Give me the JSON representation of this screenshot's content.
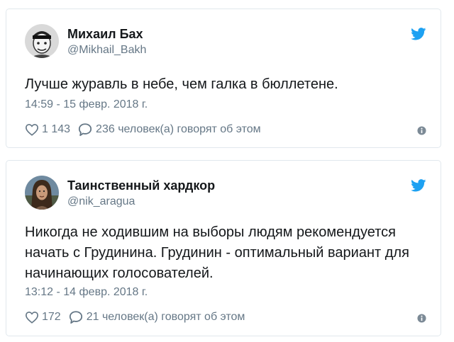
{
  "colors": {
    "twitter_blue": "#1da1f2",
    "text": "#14171a",
    "muted": "#657786",
    "border": "#e1e8ed"
  },
  "tweets": [
    {
      "author_name": "Михаил Бах",
      "handle": "@Mikhail_Bakh",
      "text": "Лучше журавль в небе, чем галка в бюллетене.",
      "timestamp": "14:59 - 15 февр. 2018 г.",
      "likes": "1 143",
      "replies_text": "236 человек(а) говорят об этом",
      "icons": [
        "twitter-bird-icon",
        "heart-icon",
        "reply-icon",
        "info-icon"
      ]
    },
    {
      "author_name": "Таинственный хардкор",
      "handle": "@nik_aragua",
      "text_lines": [
        "Никогда не ходившим на выборы людям рекомендуется",
        "начать с Грудинина. Грудинин - оптимальный вариант для",
        "начинающих голосователей."
      ],
      "timestamp": "13:12 - 14 февр. 2018 г.",
      "likes": "172",
      "replies_text": "21 человек(а) говорят об этом",
      "icons": [
        "twitter-bird-icon",
        "heart-icon",
        "reply-icon",
        "info-icon"
      ]
    }
  ]
}
